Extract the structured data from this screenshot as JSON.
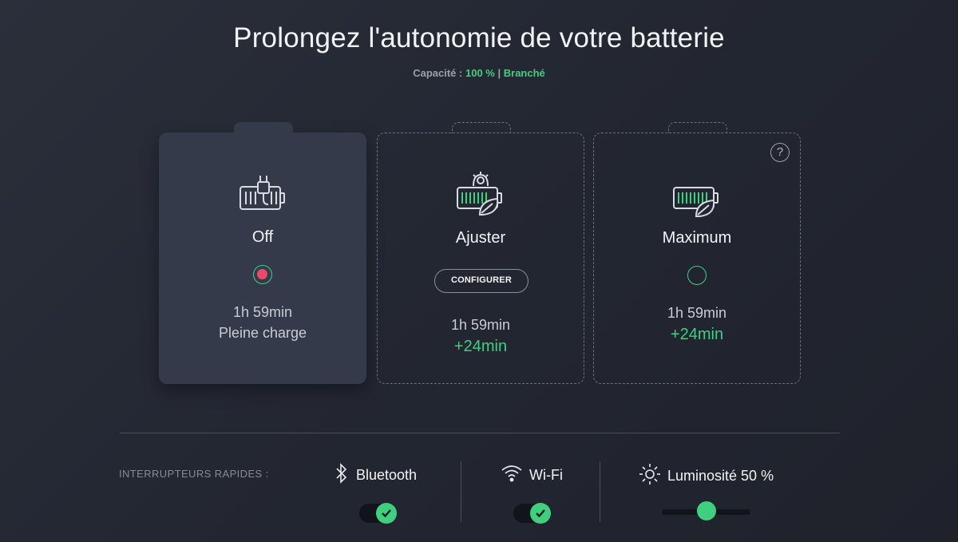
{
  "header": {
    "title": "Prolongez l'autonomie de votre batterie",
    "capacity_label": "Capacité :",
    "capacity_value": "100 %",
    "separator": "|",
    "status": "Branché"
  },
  "modes": [
    {
      "name": "Off",
      "selected": true,
      "time": "1h 59min",
      "note": "Pleine charge",
      "icon": "battery-plug-icon"
    },
    {
      "name": "Ajuster",
      "selected": false,
      "button": "CONFIGURER",
      "time": "1h 59min",
      "extra": "+24min",
      "icon": "battery-gear-leaf-icon"
    },
    {
      "name": "Maximum",
      "selected": false,
      "time": "1h 59min",
      "extra": "+24min",
      "icon": "battery-leaf-icon",
      "help": "?"
    }
  ],
  "quick_switches": {
    "label": "INTERRUPTEURS RAPIDES :",
    "bluetooth": {
      "label": "Bluetooth",
      "on": true,
      "icon": "bluetooth-icon"
    },
    "wifi": {
      "label": "Wi-Fi",
      "on": true,
      "icon": "wifi-icon"
    },
    "brightness": {
      "label": "Luminosité 50 %",
      "value_percent": 50,
      "icon": "sun-icon"
    }
  },
  "colors": {
    "accent": "#3fd07f",
    "selected_dot": "#ea4a6a",
    "card_active": "#343a4a"
  }
}
